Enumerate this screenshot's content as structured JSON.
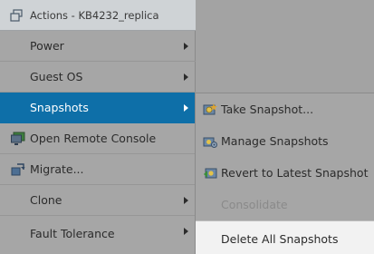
{
  "menu": {
    "header_title": "Actions - KB4232_replica",
    "items": [
      {
        "label": "Power"
      },
      {
        "label": "Guest OS"
      },
      {
        "label": "Snapshots"
      },
      {
        "label": "Open Remote Console"
      },
      {
        "label": "Migrate..."
      },
      {
        "label": "Clone"
      },
      {
        "label": "Fault Tolerance"
      }
    ]
  },
  "submenu": {
    "items": [
      {
        "label": "Take Snapshot..."
      },
      {
        "label": "Manage Snapshots"
      },
      {
        "label": "Revert to Latest Snapshot"
      },
      {
        "label": "Consolidate"
      },
      {
        "label": "Delete All Snapshots"
      }
    ]
  },
  "colors": {
    "active_highlight": "#0e6fa8",
    "overlay_gray": "#a6a6a6",
    "hover_item": "#f2f2f2"
  }
}
